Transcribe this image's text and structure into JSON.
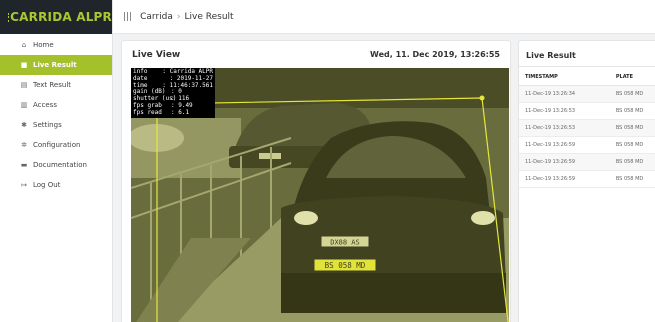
{
  "brand": {
    "name": "CARRIDA ALPR",
    "color": "#a9c733"
  },
  "sidebar": {
    "items": [
      {
        "label": "Home",
        "icon": "home-icon",
        "active": false
      },
      {
        "label": "Live Result",
        "icon": "camera-icon",
        "active": true
      },
      {
        "label": "Text Result",
        "icon": "list-icon",
        "active": false
      },
      {
        "label": "Access",
        "icon": "door-icon",
        "active": false
      },
      {
        "label": "Settings",
        "icon": "gear-icon",
        "active": false
      },
      {
        "label": "Configuration",
        "icon": "gears-icon",
        "active": false
      },
      {
        "label": "Documentation",
        "icon": "book-icon",
        "active": false
      },
      {
        "label": "Log Out",
        "icon": "logout-icon",
        "active": false
      }
    ]
  },
  "header": {
    "crumbs": [
      "Carrida",
      "Live Result"
    ]
  },
  "live_view": {
    "title": "Live View",
    "datetime": "Wed, 11. Dec 2019, 13:26:55",
    "overlay": [
      {
        "key": "info",
        "value": ": Carrida ALPR"
      },
      {
        "key": "date",
        "value": ": 2019-11-27"
      },
      {
        "key": "time",
        "value": ": 11:46:37.561"
      },
      {
        "key": "gain (dB)",
        "value": ": 0"
      },
      {
        "key": "shutter (us)",
        "value": ": 116"
      },
      {
        "key": "fps grab",
        "value": ": 9.49"
      },
      {
        "key": "fps read",
        "value": ": 6.1"
      }
    ],
    "plate_front": "DX88 AS",
    "plate_bottom": "BS 058 MD"
  },
  "live_result": {
    "title": "Live Result",
    "columns": [
      "TIMESTAMP",
      "PLATE"
    ],
    "rows": [
      [
        "11-Dec-19 13:26:34",
        "BS 058 MD"
      ],
      [
        "11-Dec-19 13:26:53",
        "BS 058 MD"
      ],
      [
        "11-Dec-19 13:26:53",
        "BS 058 MD"
      ],
      [
        "11-Dec-19 13:26:59",
        "BS 058 MD"
      ],
      [
        "11-Dec-19 13:26:59",
        "BS 058 MD"
      ],
      [
        "11-Dec-19 13:26:59",
        "BS 058 MD"
      ]
    ]
  },
  "colors": {
    "accent": "#a4c02a",
    "roi": "#e6e63a"
  }
}
